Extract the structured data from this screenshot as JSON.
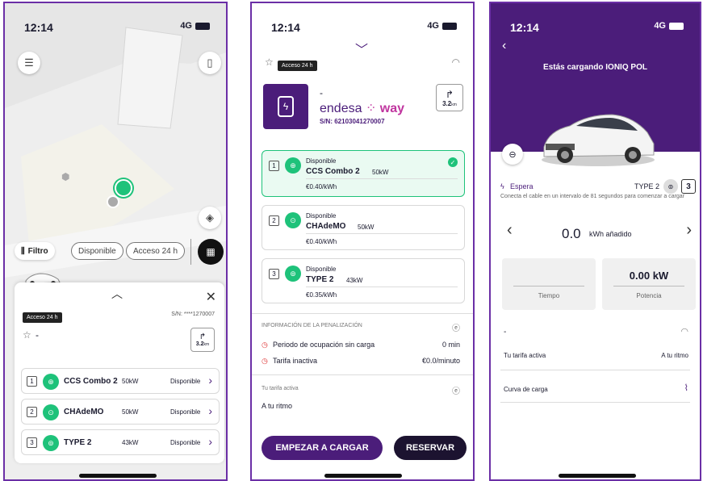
{
  "status": {
    "time": "12:14",
    "network": "4G"
  },
  "screen1": {
    "filters": [
      "Filtro",
      "Disponible",
      "Acceso 24 h"
    ],
    "access_badge": "Acceso 24 h",
    "serial": "S/N: ****1270007",
    "station_name": "-",
    "distance": "3.2",
    "distance_unit": "km",
    "connectors": [
      {
        "num": "1",
        "name": "CCS Combo 2",
        "power": "50kW",
        "status": "Disponible"
      },
      {
        "num": "2",
        "name": "CHAdeMO",
        "power": "50kW",
        "status": "Disponible"
      },
      {
        "num": "3",
        "name": "TYPE 2",
        "power": "43kW",
        "status": "Disponible"
      }
    ]
  },
  "screen2": {
    "access_badge": "Acceso 24 h",
    "station_name": "-",
    "brand": "endesa",
    "brand_suffix": "way",
    "serial": "S/N: 62103041270007",
    "distance": "3.2",
    "distance_unit": "km",
    "connectors": [
      {
        "num": "1",
        "status": "Disponible",
        "name": "CCS Combo 2",
        "power": "50kW",
        "price": "€0.40/kWh"
      },
      {
        "num": "2",
        "status": "Disponible",
        "name": "CHAdeMO",
        "power": "50kW",
        "price": "€0.40/kWh"
      },
      {
        "num": "3",
        "status": "Disponible",
        "name": "TYPE 2",
        "power": "43kW",
        "price": "€0.35/kWh"
      }
    ],
    "penalty_title": "INFORMACIÓN DE LA PENALIZACIÓN",
    "penalty_rows": [
      {
        "label": "Periodo de ocupación sin carga",
        "value": "0 min"
      },
      {
        "label": "Tarifa inactiva",
        "value": "€0.0/minuto"
      }
    ],
    "tariff_label": "Tu tarifa activa",
    "tariff_value": "A tu ritmo",
    "start_button": "EMPEZAR A CARGAR",
    "reserve_button": "RESERVAR"
  },
  "screen3": {
    "title": "Estás cargando IONIQ POL",
    "state": "Espera",
    "connector_type": "TYPE 2",
    "connector_num": "3",
    "instruction": "Conecta el cable en un intervalo de 81 segundos para comenzar a cargar",
    "energy_value": "0.0",
    "energy_unit": "kWh añadido",
    "time_label": "Tiempo",
    "power_value": "0.00 kW",
    "power_label": "Potencia",
    "dash": "-",
    "tariff_label": "Tu tarifa activa",
    "tariff_value": "A tu ritmo",
    "curve_label": "Curva de carga"
  },
  "colors": {
    "brand_purple": "#4b1d7a",
    "available_green": "#1ec27a",
    "brand_pink": "#c0359f"
  }
}
